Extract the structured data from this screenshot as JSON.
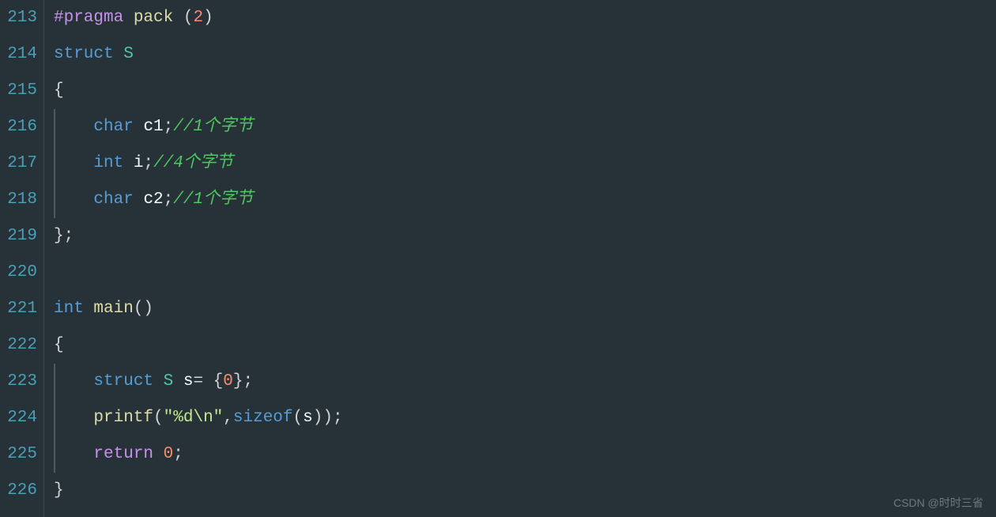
{
  "lineNumbers": [
    "213",
    "214",
    "215",
    "216",
    "217",
    "218",
    "219",
    "220",
    "221",
    "222",
    "223",
    "224",
    "225",
    "226"
  ],
  "code": {
    "l213": {
      "directive": "#pragma",
      "func": "pack",
      "open": " (",
      "arg": "2",
      "close": ")"
    },
    "l214": {
      "kw": "struct",
      "name": " S"
    },
    "l215": {
      "brace": "{"
    },
    "l216": {
      "indent": "    ",
      "type": "char",
      "var": " c1",
      "semi": ";",
      "comment": "//1个字节"
    },
    "l217": {
      "indent": "    ",
      "type": "int",
      "var": " i",
      "semi": ";",
      "comment": "//4个字节"
    },
    "l218": {
      "indent": "    ",
      "type": "char",
      "var": " c2",
      "semi": ";",
      "comment": "//1个字节"
    },
    "l219": {
      "brace": "};"
    },
    "l220": {
      "blank": ""
    },
    "l221": {
      "type": "int",
      "func": " main",
      "parens": "()"
    },
    "l222": {
      "brace": "{"
    },
    "l223": {
      "indent": "    ",
      "kw": "struct",
      "typename": " S ",
      "var": "s",
      "assign": "= {",
      "zero": "0",
      "end": "};"
    },
    "l224": {
      "indent": "    ",
      "func": "printf",
      "open": "(",
      "str": "\"%d\\n\"",
      "comma": ",",
      "sizeof": "sizeof",
      "sopen": "(",
      "arg": "s",
      "sclose": "));"
    },
    "l225": {
      "indent": "    ",
      "kw": "return",
      "sp": " ",
      "zero": "0",
      "semi": ";"
    },
    "l226": {
      "brace": "}"
    }
  },
  "watermark": "CSDN @时时三省"
}
